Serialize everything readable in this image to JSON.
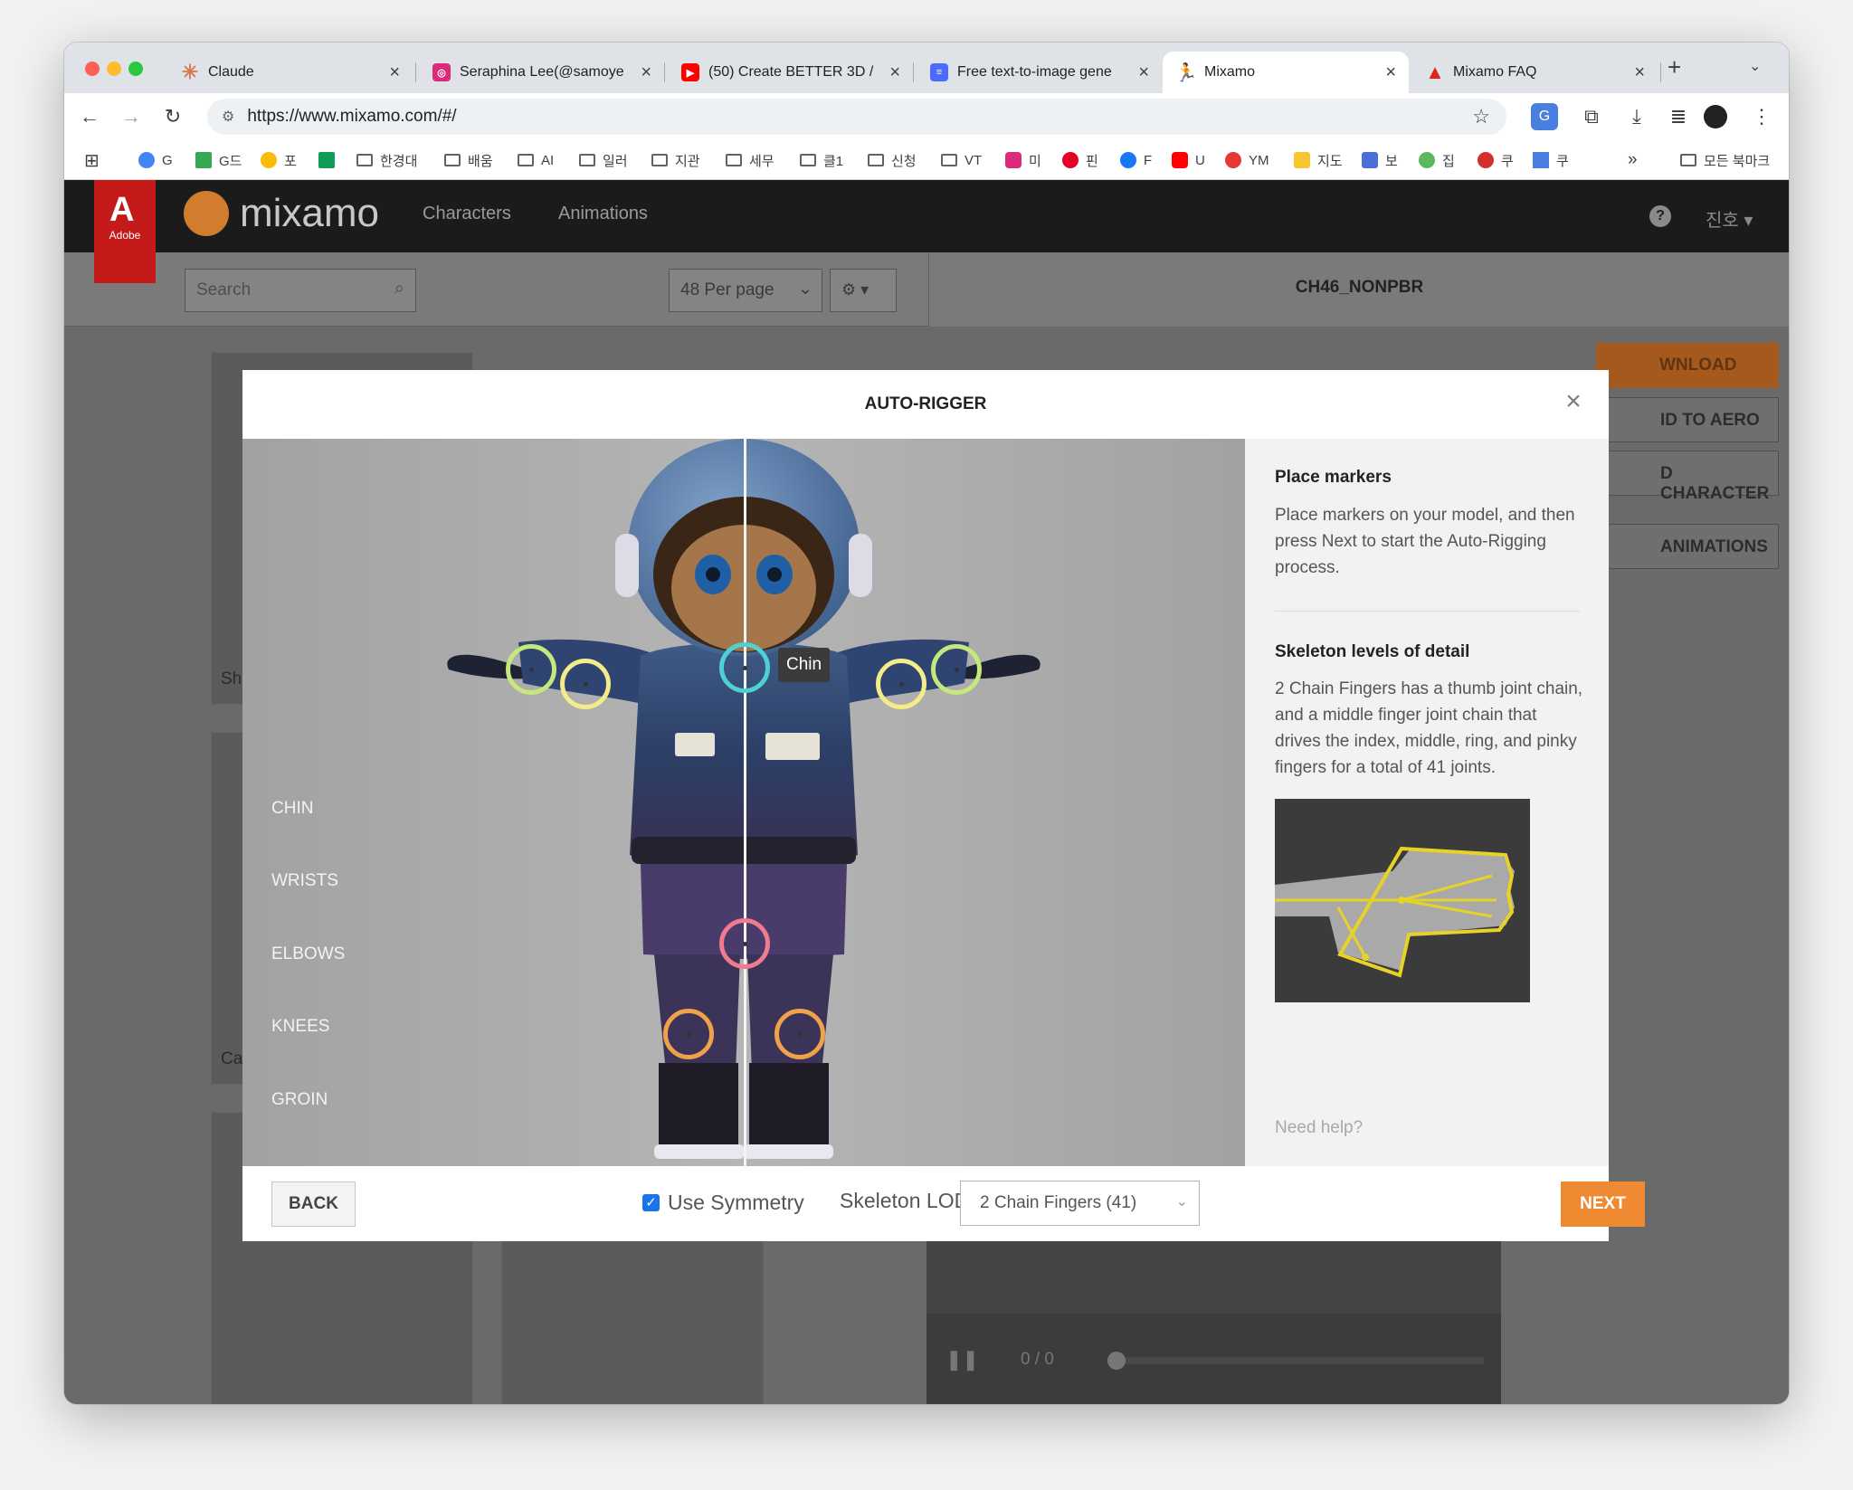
{
  "browser": {
    "tabs": [
      {
        "title": "Claude",
        "icon": "claude-icon",
        "color": "#d97757"
      },
      {
        "title": "Seraphina Lee(@samoye",
        "icon": "instagram-icon",
        "color": "#dd2a7b"
      },
      {
        "title": "(50) Create BETTER 3D /",
        "icon": "youtube-icon",
        "color": "#ff0000"
      },
      {
        "title": "Free text-to-image gene",
        "icon": "doc-icon",
        "color": "#4b6bfb"
      },
      {
        "title": "Mixamo",
        "icon": "mixamo-icon",
        "color": "#d27d2d"
      },
      {
        "title": "Mixamo FAQ",
        "icon": "adobe-icon",
        "color": "#e1251b"
      }
    ],
    "url": "https://www.mixamo.com/#/",
    "bookmarks": [
      "G",
      "G드",
      "포",
      "",
      "한경대",
      "배움",
      "AI",
      "일러",
      "지관",
      "세무",
      "클1",
      "신청",
      "VT",
      "미",
      "핀",
      "F",
      "U",
      "YM",
      "지도",
      "보",
      "집",
      "쿠",
      "쿠"
    ],
    "bookmarks_other": "모든 북마크",
    "bookmarks_more": "»"
  },
  "mixamo": {
    "brand": "mixamo",
    "adobe": "Adobe",
    "nav": [
      "Characters",
      "Animations"
    ],
    "help": "?",
    "user": "진호 ▾",
    "search_placeholder": "Search",
    "per_page": "48 Per page",
    "character_name": "CH46_NONPBR",
    "side_buttons": [
      "DOWNLOAD",
      "SEND TO AERO",
      "UPLOAD CHARACTER",
      "FIND ANIMATIONS"
    ],
    "side_buttons_visible": [
      "WNLOAD",
      "ID TO AERO",
      "D CHARACTER",
      "ANIMATIONS"
    ],
    "card_labels": [
      "Sh",
      "Ca"
    ],
    "player_time": "0 / 0"
  },
  "modal": {
    "title": "AUTO-RIGGER",
    "marker_labels": [
      "CHIN",
      "WRISTS",
      "ELBOWS",
      "KNEES",
      "GROIN"
    ],
    "tooltip": "Chin",
    "place_heading": "Place markers",
    "place_text": "Place markers on your model, and then press Next to start the Auto-Rigging process.",
    "lod_heading": "Skeleton levels of detail",
    "lod_text": "2 Chain Fingers has a thumb joint chain, and a middle finger joint chain that drives the index, middle, ring, and pinky fingers for a total of 41 joints.",
    "need_help": "Need help?",
    "back": "BACK",
    "use_symmetry": "Use Symmetry",
    "use_symmetry_checked": true,
    "skeleton_lod_label": "Skeleton LOD",
    "skeleton_lod_value": "2 Chain Fingers (41)",
    "next": "NEXT",
    "colors": {
      "chin": "#4fd1d1",
      "wrists": "#c5e87c",
      "elbows": "#f2ec8b",
      "knees": "#f0a24a",
      "groin": "#f07a8e",
      "next": "#f08a32"
    }
  }
}
